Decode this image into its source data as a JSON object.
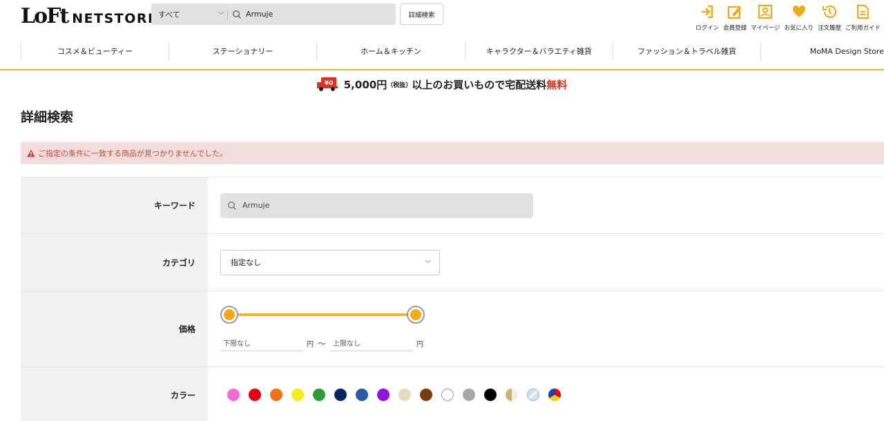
{
  "header": {
    "logo_lo": "LoFt",
    "logo_net": "NETSTORE",
    "search": {
      "category": "すべて",
      "value": "Armuje"
    },
    "advanced_button": "詳細検索",
    "user_menu": [
      {
        "label": "ログイン",
        "icon": "login-icon"
      },
      {
        "label": "会員登録",
        "icon": "register-icon"
      },
      {
        "label": "マイページ",
        "icon": "mypage-icon"
      },
      {
        "label": "お気に入り",
        "icon": "heart-icon"
      },
      {
        "label": "注文履歴",
        "icon": "history-icon"
      },
      {
        "label": "ご利用ガイド",
        "icon": "guide-icon"
      }
    ],
    "accent_color": "#f5a914"
  },
  "nav": {
    "items": [
      "コスメ＆ビューティー",
      "ステーショナリー",
      "ホーム＆キッチン",
      "キャラクター＆バラエティ雑貨",
      "ファッション＆トラベル雑貨",
      "MoMA Design Store"
    ]
  },
  "banner": {
    "truck_text": "¥0",
    "amount": "5,000円",
    "tax": "（税抜）",
    "mid": "以上のお買いもので宅配送料",
    "free": "無料"
  },
  "page": {
    "title": "詳細検索",
    "alert": "ご指定の条件に一致する商品が見つかりませんでした。"
  },
  "form": {
    "keyword": {
      "label": "キーワード",
      "value": "Armuje"
    },
    "category": {
      "label": "カテゴリ",
      "value": "指定なし"
    },
    "price": {
      "label": "価格",
      "min_placeholder": "下限なし",
      "max_placeholder": "上限なし",
      "unit": "円",
      "separator": "〜"
    },
    "color": {
      "label": "カラー",
      "swatches": [
        {
          "name": "pink",
          "color": "#f06ad8"
        },
        {
          "name": "red",
          "color": "#e60012"
        },
        {
          "name": "orange",
          "color": "#f07318"
        },
        {
          "name": "yellow",
          "color": "#f5ee1a"
        },
        {
          "name": "green",
          "color": "#2f9a3a"
        },
        {
          "name": "navy",
          "color": "#0b2560"
        },
        {
          "name": "blue",
          "color": "#2a5aa8"
        },
        {
          "name": "purple",
          "color": "#8f14e0"
        },
        {
          "name": "beige",
          "color": "#e8dcbf"
        },
        {
          "name": "brown",
          "color": "#7a3d0f"
        },
        {
          "name": "white",
          "color": "#ffffff"
        },
        {
          "name": "gray",
          "color": "#a6a6a6"
        },
        {
          "name": "black",
          "color": "#000000"
        },
        {
          "name": "gold",
          "color": "#c9b27a"
        },
        {
          "name": "silver",
          "color": "#cfe2f7"
        },
        {
          "name": "multi",
          "color": "#e60012"
        }
      ]
    }
  }
}
